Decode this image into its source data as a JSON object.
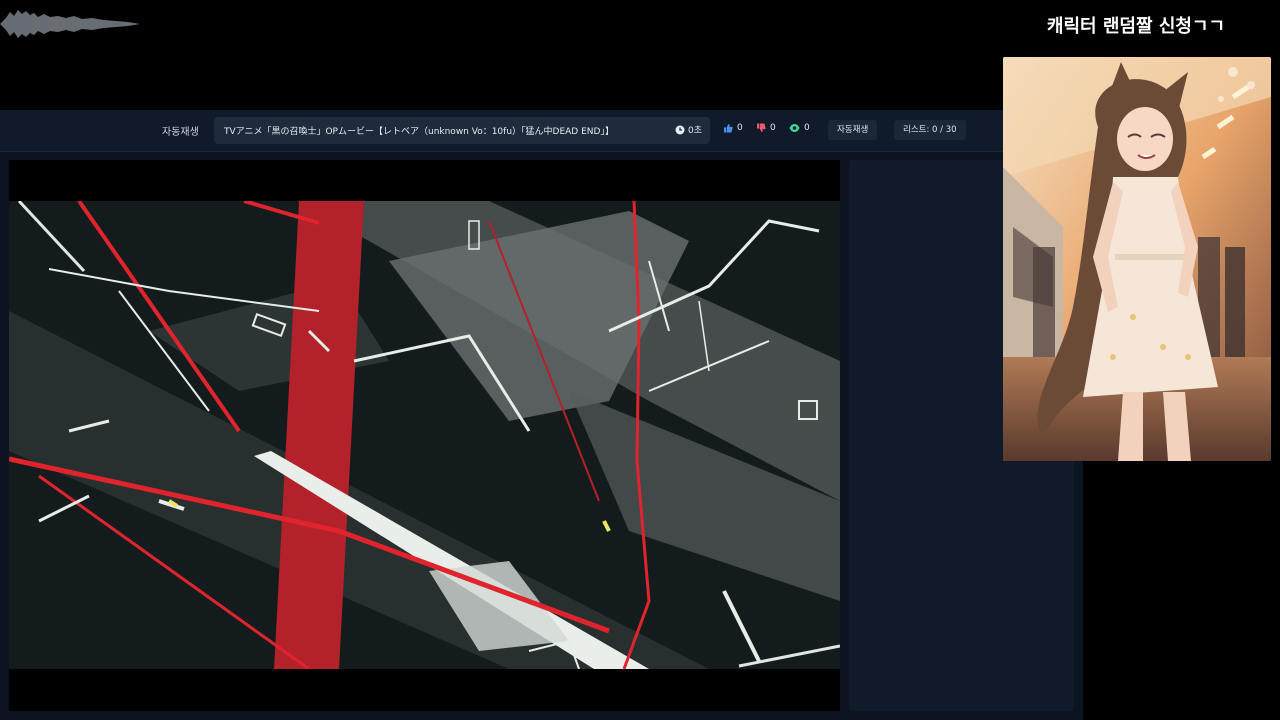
{
  "overlay": {
    "title": "캐릭터 랜덤짤 신청ㄱㄱ"
  },
  "toolbar": {
    "autoplay_label": "자동재생",
    "now_playing_title": "TVアニメ「黒の召喚士」OPムービー【レトベア（unknown Vo：10fu）「猛ん中DEAD END」】",
    "elapsed": "0초",
    "likes": "0",
    "dislikes": "0",
    "views": "0",
    "autoplay_button": "자동재생",
    "playlist": "리스트: 0 / 30"
  },
  "icons": {
    "clock": "clock-icon",
    "like": "thumbs-up-icon",
    "dislike": "thumbs-down-icon",
    "views": "eye-icon"
  },
  "colors": {
    "like": "#4a8ef0",
    "dislike": "#f05a6e",
    "views": "#3ddc97",
    "panel": "#0c1422"
  }
}
